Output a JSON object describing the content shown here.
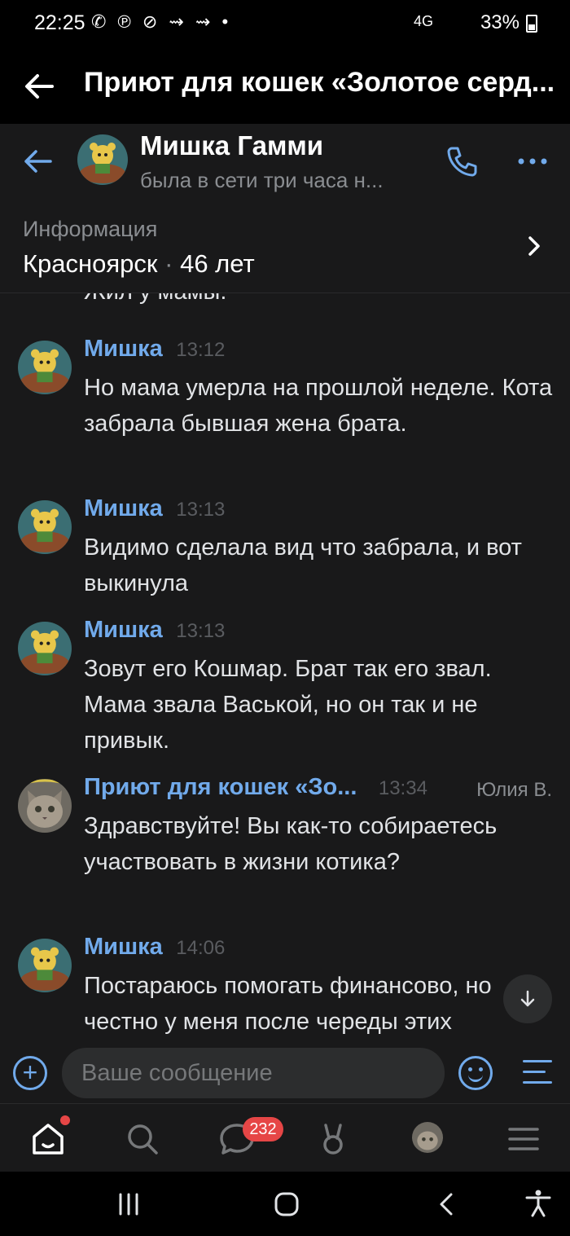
{
  "status_bar": {
    "time": "22:25",
    "notification_icons": "✆ ℗ ⊘ ⇝ ⇝ •",
    "network": "4G",
    "battery": "33%"
  },
  "community_header": {
    "title": "Приют для кошек «Золотое серд..."
  },
  "chat_header": {
    "name": "Мишка Гамми",
    "status": "была в сети три часа н..."
  },
  "info": {
    "label": "Информация",
    "city": "Красноярск",
    "separator": "·",
    "age": "46 лет"
  },
  "partial_top_line": "Жил у мамы.",
  "messages": [
    {
      "name": "Мишка",
      "time": "13:12",
      "author": "",
      "avatar": "gummy-bear",
      "text": "Но мама умерла на прошлой неделе. Кота забрала бывшая жена брата."
    },
    {
      "name": "Мишка",
      "time": "13:13",
      "author": "",
      "avatar": "gummy-bear",
      "text": "Видимо сделала вид что забрала, и вот выкинула"
    },
    {
      "name": "Мишка",
      "time": "13:13",
      "author": "",
      "avatar": "gummy-bear",
      "text": "Зовут его Кошмар. Брат так его звал. Мама звала Васькой, но он так и не привык."
    },
    {
      "name": "Приют для кошек «Зо...",
      "time": "13:34",
      "author": "Юлия В.",
      "avatar": "cat",
      "text": "Здравствуйте! Вы как-то собираетесь участвовать в жизни котика?"
    },
    {
      "name": "Мишка",
      "time": "14:06",
      "author": "",
      "avatar": "gummy-bear",
      "text": "Постараюсь помогать финансово, но честно у меня после череды этих"
    }
  ],
  "composer": {
    "placeholder": "Ваше сообщение"
  },
  "bottom_nav": {
    "messages_badge": "232"
  },
  "colors": {
    "accent": "#71aaeb",
    "background": "#19191a",
    "badge": "#e64646"
  }
}
